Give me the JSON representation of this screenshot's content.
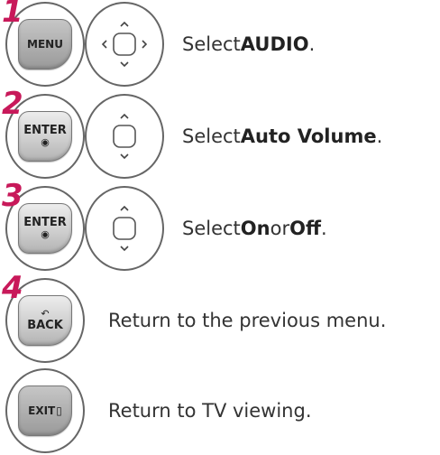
{
  "steps": [
    {
      "number": "1",
      "button_label": "MENU",
      "text_before": "Select ",
      "text_bold": "AUDIO",
      "text_after": "."
    },
    {
      "number": "2",
      "button_label": "ENTER",
      "button_sub": "◉",
      "text_before": "Select ",
      "text_bold": "Auto Volume",
      "text_after": "."
    },
    {
      "number": "3",
      "button_label": "ENTER",
      "button_sub": "◉",
      "text_before": "Select ",
      "text_bold": "On",
      "text_mid": " or ",
      "text_bold2": "Off",
      "text_after": "."
    },
    {
      "number": "4",
      "button_icon": "↶",
      "button_label": "BACK",
      "text": "Return to the previous menu."
    },
    {
      "button_label": "EXIT",
      "button_icon": "▯",
      "text": "Return to TV viewing."
    }
  ]
}
